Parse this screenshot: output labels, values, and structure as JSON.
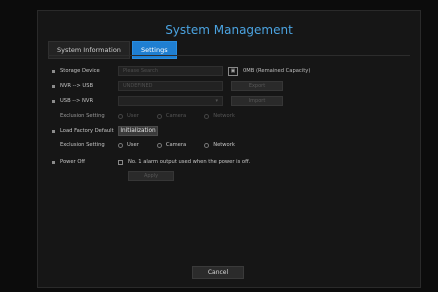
{
  "header": {
    "title": "System Management"
  },
  "tabs": [
    {
      "label": "System Information",
      "active": false
    },
    {
      "label": "Settings",
      "active": true
    }
  ],
  "storage": {
    "label": "Storage Device",
    "placeholder": "Please Search",
    "folder_icon": "folder-icon",
    "capacity_text": "0MB (Remained Capacity)"
  },
  "nvr_usb": {
    "label": "NVR --> USB",
    "value": "UNDEFINED",
    "button": "Export"
  },
  "usb_nvr": {
    "label": "USB --> NVR",
    "value": "",
    "button": "Import"
  },
  "exclusion1": {
    "label": "Exclusion Setting",
    "options": [
      "User",
      "Camera",
      "Network"
    ]
  },
  "factory": {
    "label": "Load Factory Default",
    "button": "Initialization"
  },
  "exclusion2": {
    "label": "Exclusion Setting",
    "options": [
      "User",
      "Camera",
      "Network"
    ]
  },
  "power": {
    "label": "Power Off",
    "checkbox_text": "No. 1 alarm output used when the power is off.",
    "apply_label": "Apply"
  },
  "footer": {
    "cancel_label": "Cancel"
  },
  "colors": {
    "accent": "#1f7fd2",
    "title": "#4ba3e0"
  }
}
